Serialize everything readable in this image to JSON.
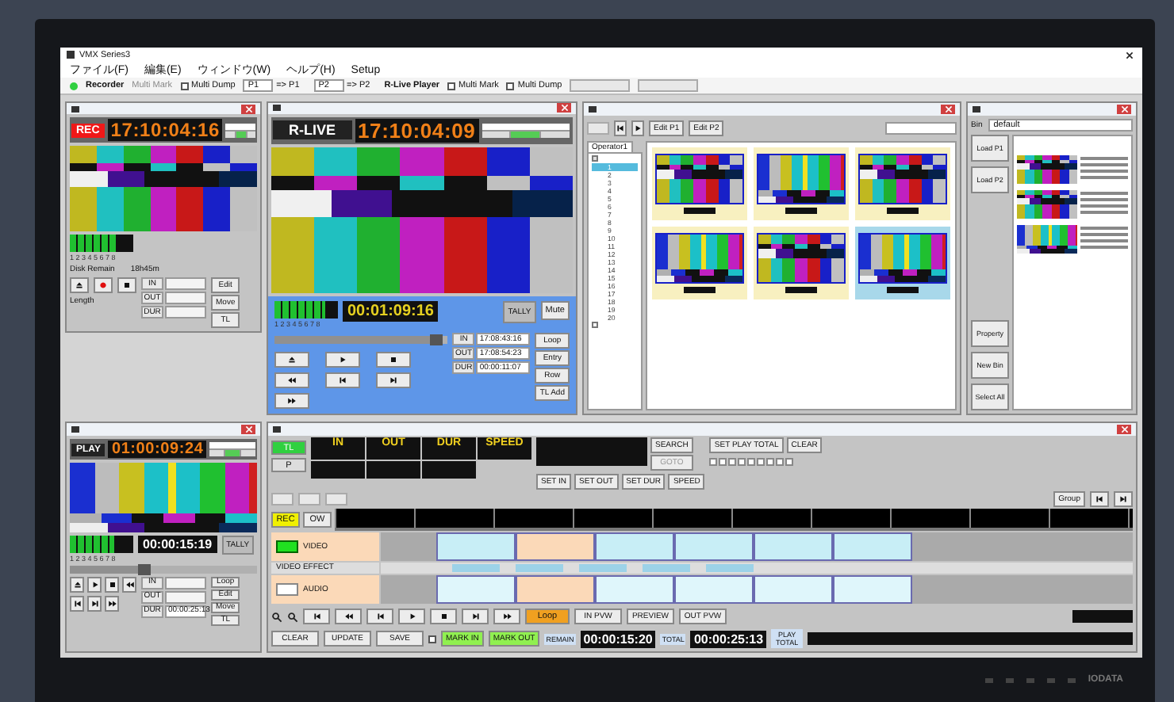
{
  "window": {
    "title": "VMX Series3"
  },
  "menu": [
    {
      "label": "ファイル(F)",
      "disabled": false
    },
    {
      "label": "編集(E)",
      "disabled": false
    },
    {
      "label": "ウィンドウ(W)",
      "disabled": false
    },
    {
      "label": "ヘルプ(H)",
      "disabled": false
    },
    {
      "label": "Setup",
      "disabled": false
    }
  ],
  "toolbar": {
    "recorder": {
      "label": "Recorder",
      "on": true
    },
    "recorder_mark": "Multi Mark",
    "recorder_dump": {
      "label": "Multi Dump",
      "checked": false
    },
    "targets": [
      {
        "value": "P1",
        "label": "=> P1"
      },
      {
        "value": "P2",
        "label": "=> P2"
      }
    ],
    "player": "R-Live Player",
    "player_mark": {
      "label": "Multi Mark",
      "checked": false
    },
    "player_dump": {
      "label": "Multi Dump",
      "checked": false
    }
  },
  "recorder": {
    "badge": "REC",
    "timecode": "17:10:04:16",
    "meter": {
      "level": 0.75,
      "label": "1 2 3 4 5 6 7 8"
    },
    "status": "Disk Remain",
    "remain": "18h45m",
    "length": "Length",
    "fields": [
      {
        "label": "IN"
      },
      {
        "label": "OUT"
      },
      {
        "label": "DUR"
      }
    ],
    "side": [
      "Edit",
      "Move",
      "TL"
    ]
  },
  "player": {
    "badge": "R-LIVE",
    "timecode": "17:10:04:09",
    "meter": {
      "level": 0.8,
      "label": "1 2 3 4 5 6 7 8"
    },
    "counter": "00:01:09:16",
    "position": {
      "level": 0.93
    },
    "tally": "TALLY",
    "mute": "Mute",
    "fields": [
      {
        "label": "IN",
        "value": "17:08:43:16"
      },
      {
        "label": "OUT",
        "value": "17:08:54:23"
      },
      {
        "label": "DUR",
        "value": "00:00:11:07"
      }
    ],
    "side": [
      "Loop",
      "Entry",
      "Row",
      "TL Add"
    ]
  },
  "browser": {
    "buttons": [
      "Edit P1",
      "Edit P2"
    ],
    "tab": "Operator1",
    "tree": [
      {
        "expanded": true,
        "children": [
          {
            "label": "1",
            "selected": true
          },
          {
            "label": "2",
            "selected": false
          },
          {
            "label": "3",
            "selected": false
          },
          {
            "label": "4",
            "selected": false
          },
          {
            "label": "5",
            "selected": false
          },
          {
            "label": "6",
            "selected": false
          },
          {
            "label": "7",
            "selected": false
          },
          {
            "label": "8",
            "selected": false
          },
          {
            "label": "9",
            "selected": false
          },
          {
            "label": "10",
            "selected": false
          },
          {
            "label": "11",
            "selected": false
          },
          {
            "label": "12",
            "selected": false
          },
          {
            "label": "13",
            "selected": false
          },
          {
            "label": "14",
            "selected": false
          },
          {
            "label": "15",
            "selected": false
          },
          {
            "label": "16",
            "selected": false
          },
          {
            "label": "17",
            "selected": false
          },
          {
            "label": "18",
            "selected": false
          },
          {
            "label": "19",
            "selected": false
          },
          {
            "label": "20",
            "selected": false
          }
        ]
      },
      {
        "expanded": false
      }
    ],
    "thumbnails": [
      {
        "selected": false
      },
      {
        "selected": false
      },
      {
        "selected": false
      },
      {
        "selected": false
      },
      {
        "selected": false
      },
      {
        "selected": true
      }
    ]
  },
  "bin": {
    "label": "Bin",
    "value": "default",
    "buttons": [
      "Load P1",
      "Load P2",
      "Property",
      "New Bin",
      "Select All"
    ],
    "clips": [
      {
        "selected": false
      },
      {
        "selected": false
      },
      {
        "selected": false
      }
    ]
  },
  "player2": {
    "badge": "PLAY",
    "timecode": "01:00:09:24",
    "meter": {
      "level": 0.7,
      "label": "1 2 3 4 5 6 7 8"
    },
    "counter": "00:00:15:19",
    "position": {
      "level": 0.4
    },
    "tally": "TALLY",
    "fields": [
      {
        "label": "IN"
      },
      {
        "label": "OUT"
      },
      {
        "label": "DUR",
        "value": "00:00:25:13"
      }
    ],
    "side": [
      "Loop",
      "Edit",
      "Move",
      "TL"
    ]
  },
  "timeline": {
    "columns": [
      "IN",
      "OUT",
      "DUR",
      "SPEED"
    ],
    "modes": [
      {
        "label": "TL",
        "selected": true
      },
      {
        "label": "P",
        "selected": false
      }
    ],
    "search": [
      "SEARCH",
      "GOTO"
    ],
    "set_buttons": [
      "SET IN",
      "SET OUT",
      "SET DUR",
      "SPEED"
    ],
    "set_play_total": "SET PLAY TOTAL",
    "clear": "CLEAR",
    "group": "Group",
    "rec": {
      "label": "REC",
      "on": true
    },
    "ow": "OW",
    "tracks": [
      {
        "kind": "clips",
        "label": "VIDEO",
        "on": true,
        "clips": [
          {
            "color": "#c8eef6"
          },
          {
            "color": "#fbd9b8"
          },
          {
            "color": "#c8eef6"
          },
          {
            "color": "#c8eef6"
          },
          {
            "color": "#c8eef6"
          },
          {
            "color": "#c8eef6"
          }
        ]
      },
      {
        "kind": "effect",
        "label": "VIDEO EFFECT"
      },
      {
        "kind": "clips",
        "label": "AUDIO",
        "on": false,
        "clips": [
          {
            "color": "#dff6fb"
          },
          {
            "color": "#fbd9b8"
          },
          {
            "color": "#dff6fb"
          },
          {
            "color": "#dff6fb"
          },
          {
            "color": "#dff6fb"
          },
          {
            "color": "#dff6fb"
          }
        ]
      }
    ],
    "wave": {
      "checked": false
    },
    "loop": "Loop",
    "preview": [
      "IN PVW",
      "PREVIEW",
      "OUT PVW"
    ],
    "edit": [
      "CLEAR",
      "UPDATE",
      "SAVE"
    ],
    "marks": [
      "MARK IN",
      "MARK OUT"
    ],
    "remain": {
      "label": "REMAIN",
      "value": "00:00:15:20"
    },
    "total": {
      "label": "TOTAL",
      "value": "00:00:25:13"
    },
    "play_total": "PLAY TOTAL"
  },
  "monitor": {
    "logo": "IODATA"
  }
}
